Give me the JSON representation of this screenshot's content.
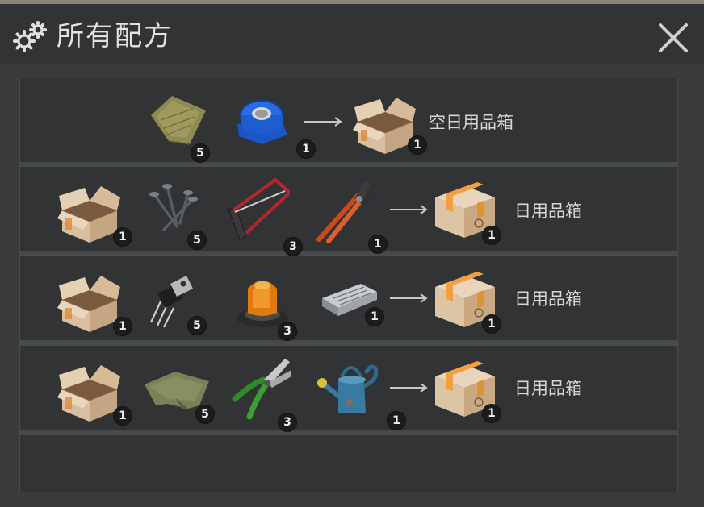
{
  "window": {
    "title": "所有配方",
    "gear_icon": "gears-icon",
    "close_icon": "close-icon"
  },
  "recipes": [
    {
      "ingredients": [
        {
          "icon": "burlap-cloth-icon",
          "count": "5"
        },
        {
          "icon": "blue-duct-tape-icon",
          "count": "1"
        }
      ],
      "result": {
        "icon": "open-cardboard-box-icon",
        "count": "1",
        "label": "空日用品箱"
      }
    },
    {
      "ingredients": [
        {
          "icon": "open-cardboard-box-icon",
          "count": "1"
        },
        {
          "icon": "nails-icon",
          "count": "5"
        },
        {
          "icon": "hacksaw-icon",
          "count": "3"
        },
        {
          "icon": "pincers-icon",
          "count": "1"
        }
      ],
      "result": {
        "icon": "sealed-cardboard-box-icon",
        "count": "1",
        "label": "日用品箱"
      }
    },
    {
      "ingredients": [
        {
          "icon": "open-cardboard-box-icon",
          "count": "1"
        },
        {
          "icon": "transistor-icon",
          "count": "5"
        },
        {
          "icon": "orange-beacon-light-icon",
          "count": "3"
        },
        {
          "icon": "electronic-module-icon",
          "count": "1"
        }
      ],
      "result": {
        "icon": "sealed-cardboard-box-icon",
        "count": "1",
        "label": "日用品箱"
      }
    },
    {
      "ingredients": [
        {
          "icon": "open-cardboard-box-icon",
          "count": "1"
        },
        {
          "icon": "green-cloth-icon",
          "count": "5"
        },
        {
          "icon": "pruning-shears-icon",
          "count": "3"
        },
        {
          "icon": "watering-can-icon",
          "count": "1"
        }
      ],
      "result": {
        "icon": "sealed-cardboard-box-icon",
        "count": "1",
        "label": "日用品箱"
      }
    }
  ],
  "colors": {
    "background": "#3a3b3b",
    "header": "#323334",
    "row": "#323335",
    "text": "#d6d6d6"
  }
}
